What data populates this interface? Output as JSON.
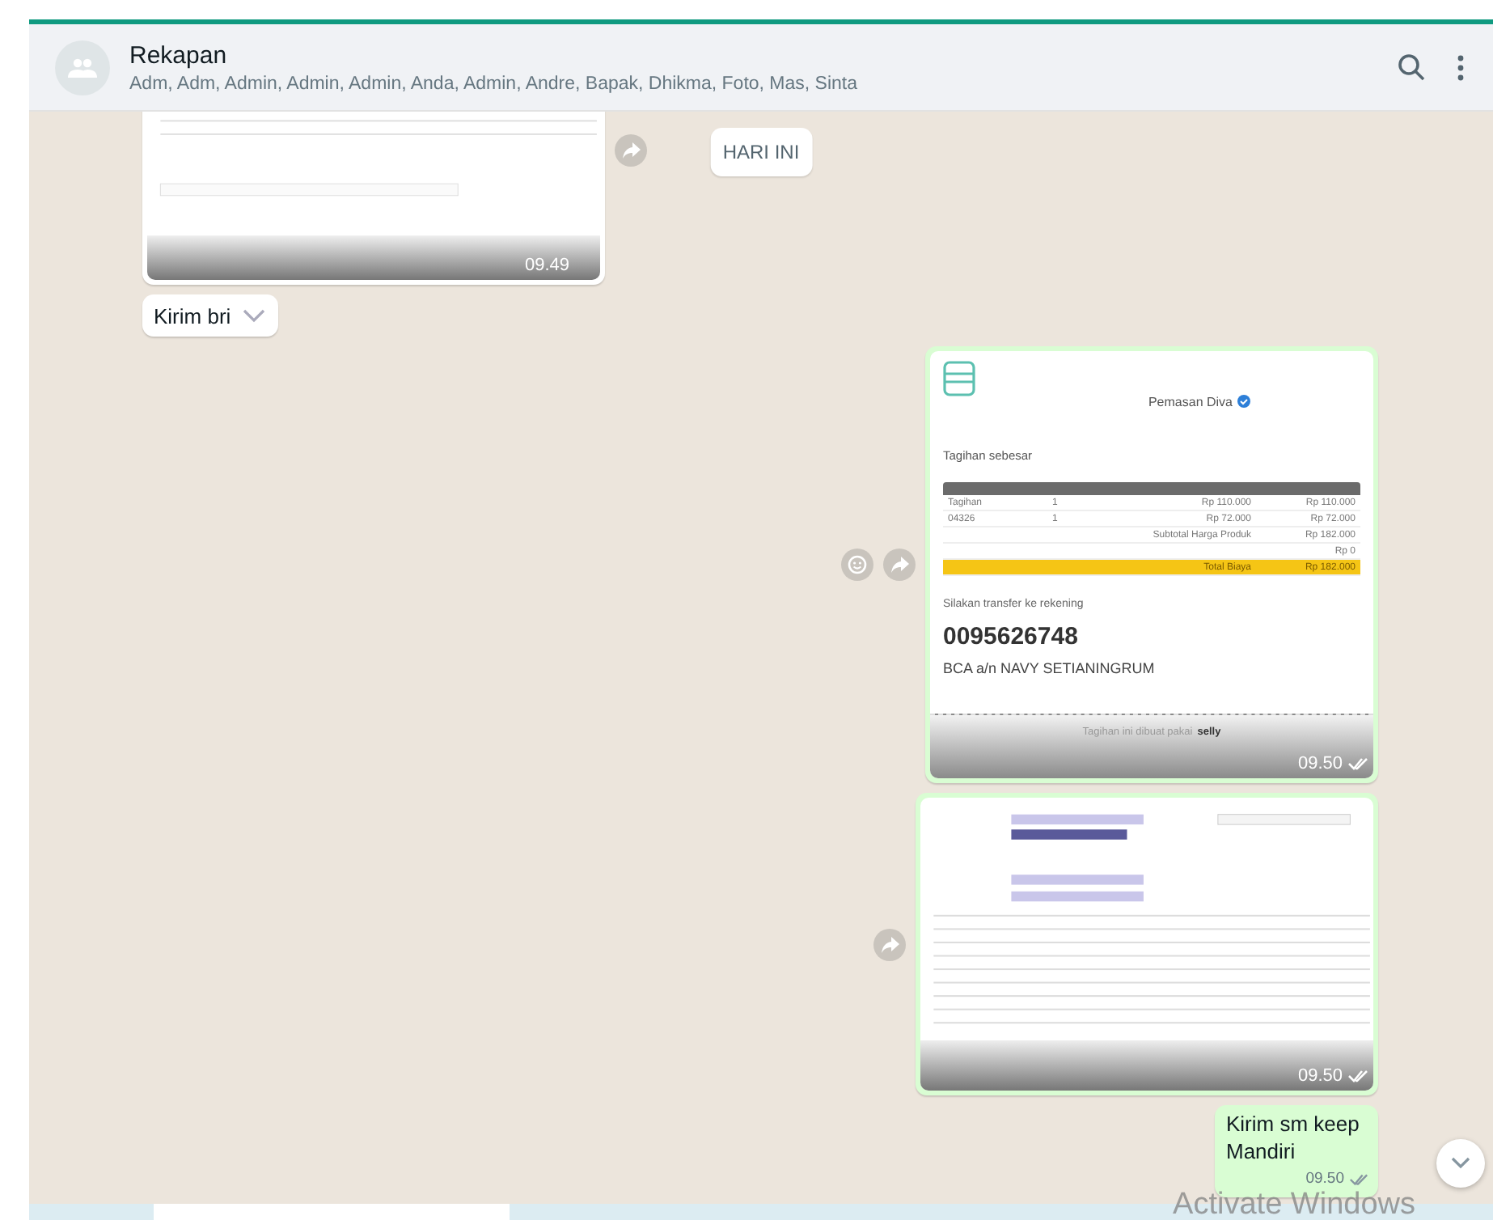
{
  "header": {
    "title": "Rekapan",
    "members": "Adm, Adm, Admin, Admin, Admin, Anda, Admin, Andre, Bapak, Dhikma, Foto, Mas, Sinta"
  },
  "date_chip": "HARI INI",
  "messages": [
    {
      "outgoing": false,
      "time": "09.49"
    },
    {
      "kind": "text",
      "outgoing": false,
      "text": "Kirim bri"
    },
    {
      "kind": "invoice",
      "outgoing": true,
      "time": "09.50",
      "invoice": {
        "store": "Pemasan Diva",
        "heading": "Tagihan sebesar",
        "rows": [
          {
            "item": "Tagihan",
            "qty": "1",
            "price": "Rp 110.000",
            "total": "Rp 110.000"
          },
          {
            "item": "04326",
            "qty": "1",
            "price": "Rp 72.000",
            "total": "Rp 72.000"
          }
        ],
        "subtotal_label": "Subtotal Harga Produk",
        "subtotal": "Rp 182.000",
        "extra": "Rp 0",
        "total_label": "Total Biaya",
        "total": "Rp 182.000",
        "transfer_note": "Silakan transfer ke rekening",
        "account": "0095626748",
        "account_name": "BCA a/n NAVY SETIANINGRUM",
        "footer": "Tagihan ini dibuat pakai",
        "brand": "selly"
      }
    },
    {
      "outgoing": true,
      "time": "09.50"
    },
    {
      "kind": "text",
      "outgoing": true,
      "text": "Kirim sm keep Mandiri",
      "time": "09.50"
    }
  ],
  "os_notice": "Activate Windows"
}
